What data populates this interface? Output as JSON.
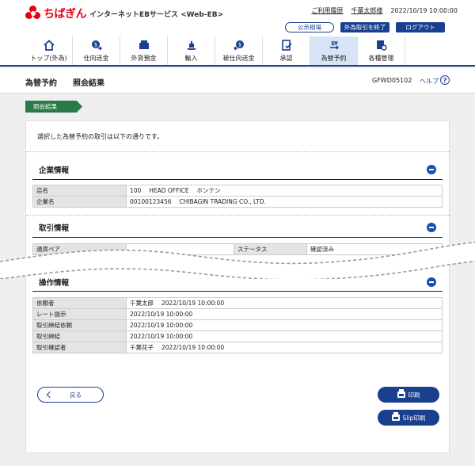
{
  "header": {
    "brand": "ちばぎん",
    "service": "インターネットEBサービス <Web-EB>",
    "usage_history": "ご利用履歴",
    "user_name": "千葉太郎様",
    "datetime": "2022/10/19 10:00:00",
    "buttons": {
      "rates": "公示相場",
      "end_fx": "外為取引を終了",
      "logout": "ログアウト"
    }
  },
  "nav": [
    {
      "label": "トップ(外為)",
      "icon": "home-icon"
    },
    {
      "label": "仕向送金",
      "icon": "send-money-icon"
    },
    {
      "label": "外貨預金",
      "icon": "deposit-icon"
    },
    {
      "label": "輸入",
      "icon": "import-icon"
    },
    {
      "label": "被仕向送金",
      "icon": "receive-money-icon"
    },
    {
      "label": "承認",
      "icon": "approve-icon"
    },
    {
      "label": "為替予約",
      "icon": "fx-reservation-icon",
      "active": true
    },
    {
      "label": "各種管理",
      "icon": "management-icon"
    }
  ],
  "page": {
    "title": "為替予約",
    "subtitle": "照会結果",
    "screen_id": "GFWD05102",
    "help": "ヘルプ",
    "step": "照会結果",
    "intro": "選択した為替予約の取引は以下の通りです。"
  },
  "sections": {
    "company": {
      "title": "企業情報",
      "rows": [
        {
          "k": "店名",
          "v": "100　 HEAD OFFICE　 ホンテン"
        },
        {
          "k": "企業名",
          "v": "00100123456　 CHIBAGIN TRADING CO., LTD."
        }
      ]
    },
    "transaction": {
      "title": "取引情報",
      "rows": [
        {
          "k": "通貨ペア",
          "v": "",
          "k2": "ステータス",
          "v2": "確認済み"
        }
      ]
    },
    "operation": {
      "title": "操作情報",
      "rows": [
        {
          "k": "依頼者",
          "v": "千葉太郎　 2022/10/19 10:00:00"
        },
        {
          "k": "レート提示",
          "v": "2022/10/19 10:00:00"
        },
        {
          "k": "取引締結依頼",
          "v": "2022/10/19 10:00:00"
        },
        {
          "k": "取引締結",
          "v": "2022/10/19 10:00:00"
        },
        {
          "k": "取引確認者",
          "v": "千葉花子　 2022/10/19 10:00:00"
        }
      ]
    }
  },
  "actions": {
    "back": "戻る",
    "print": "印刷",
    "slip_print": "Slip印刷"
  }
}
